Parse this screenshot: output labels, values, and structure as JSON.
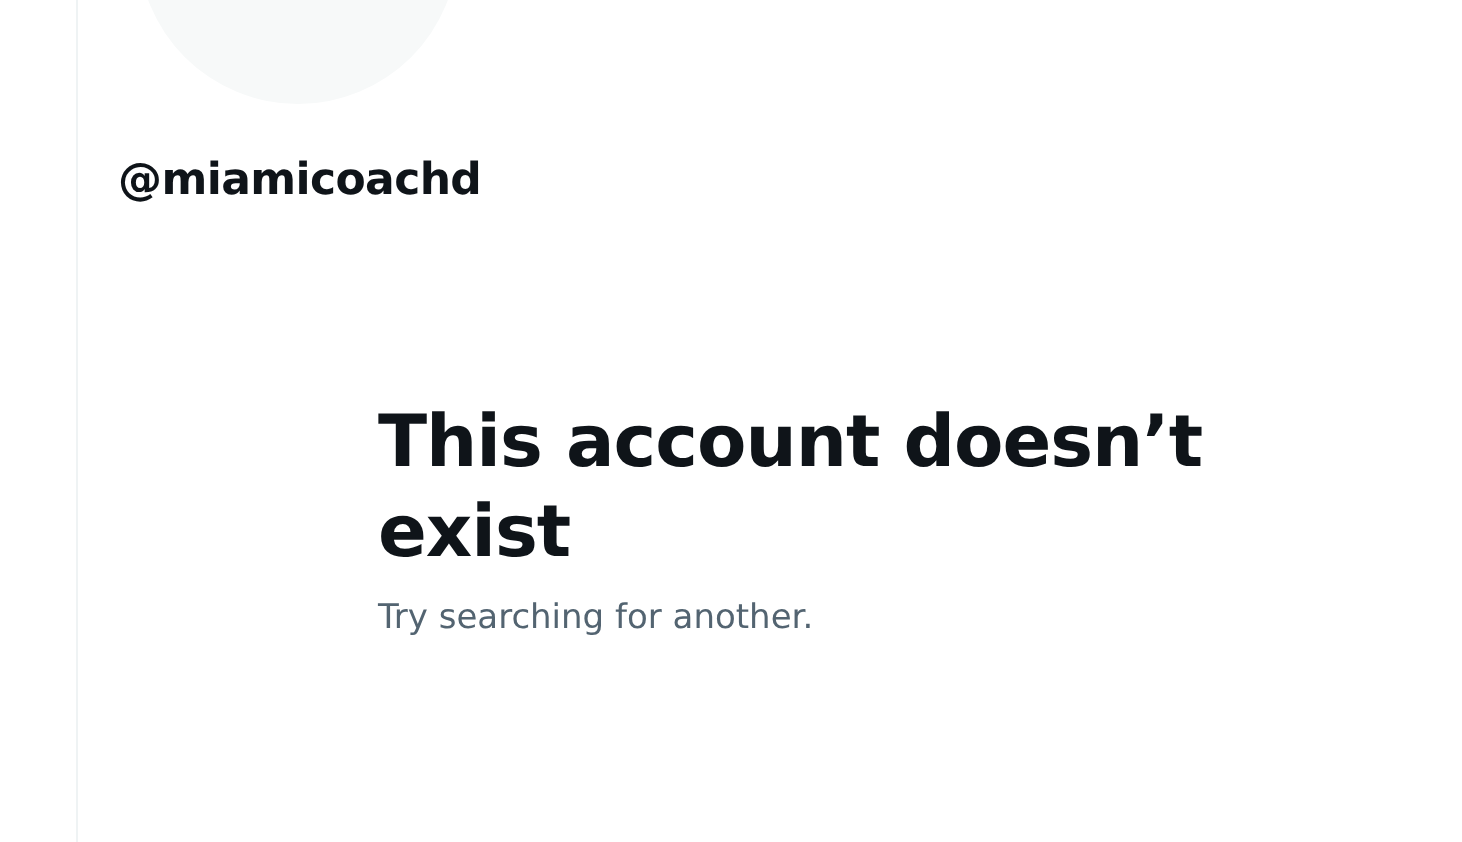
{
  "profile": {
    "handle": "@miamicoachd"
  },
  "empty_state": {
    "title": "This account doesn’t exist",
    "subtitle": "Try searching for another."
  }
}
